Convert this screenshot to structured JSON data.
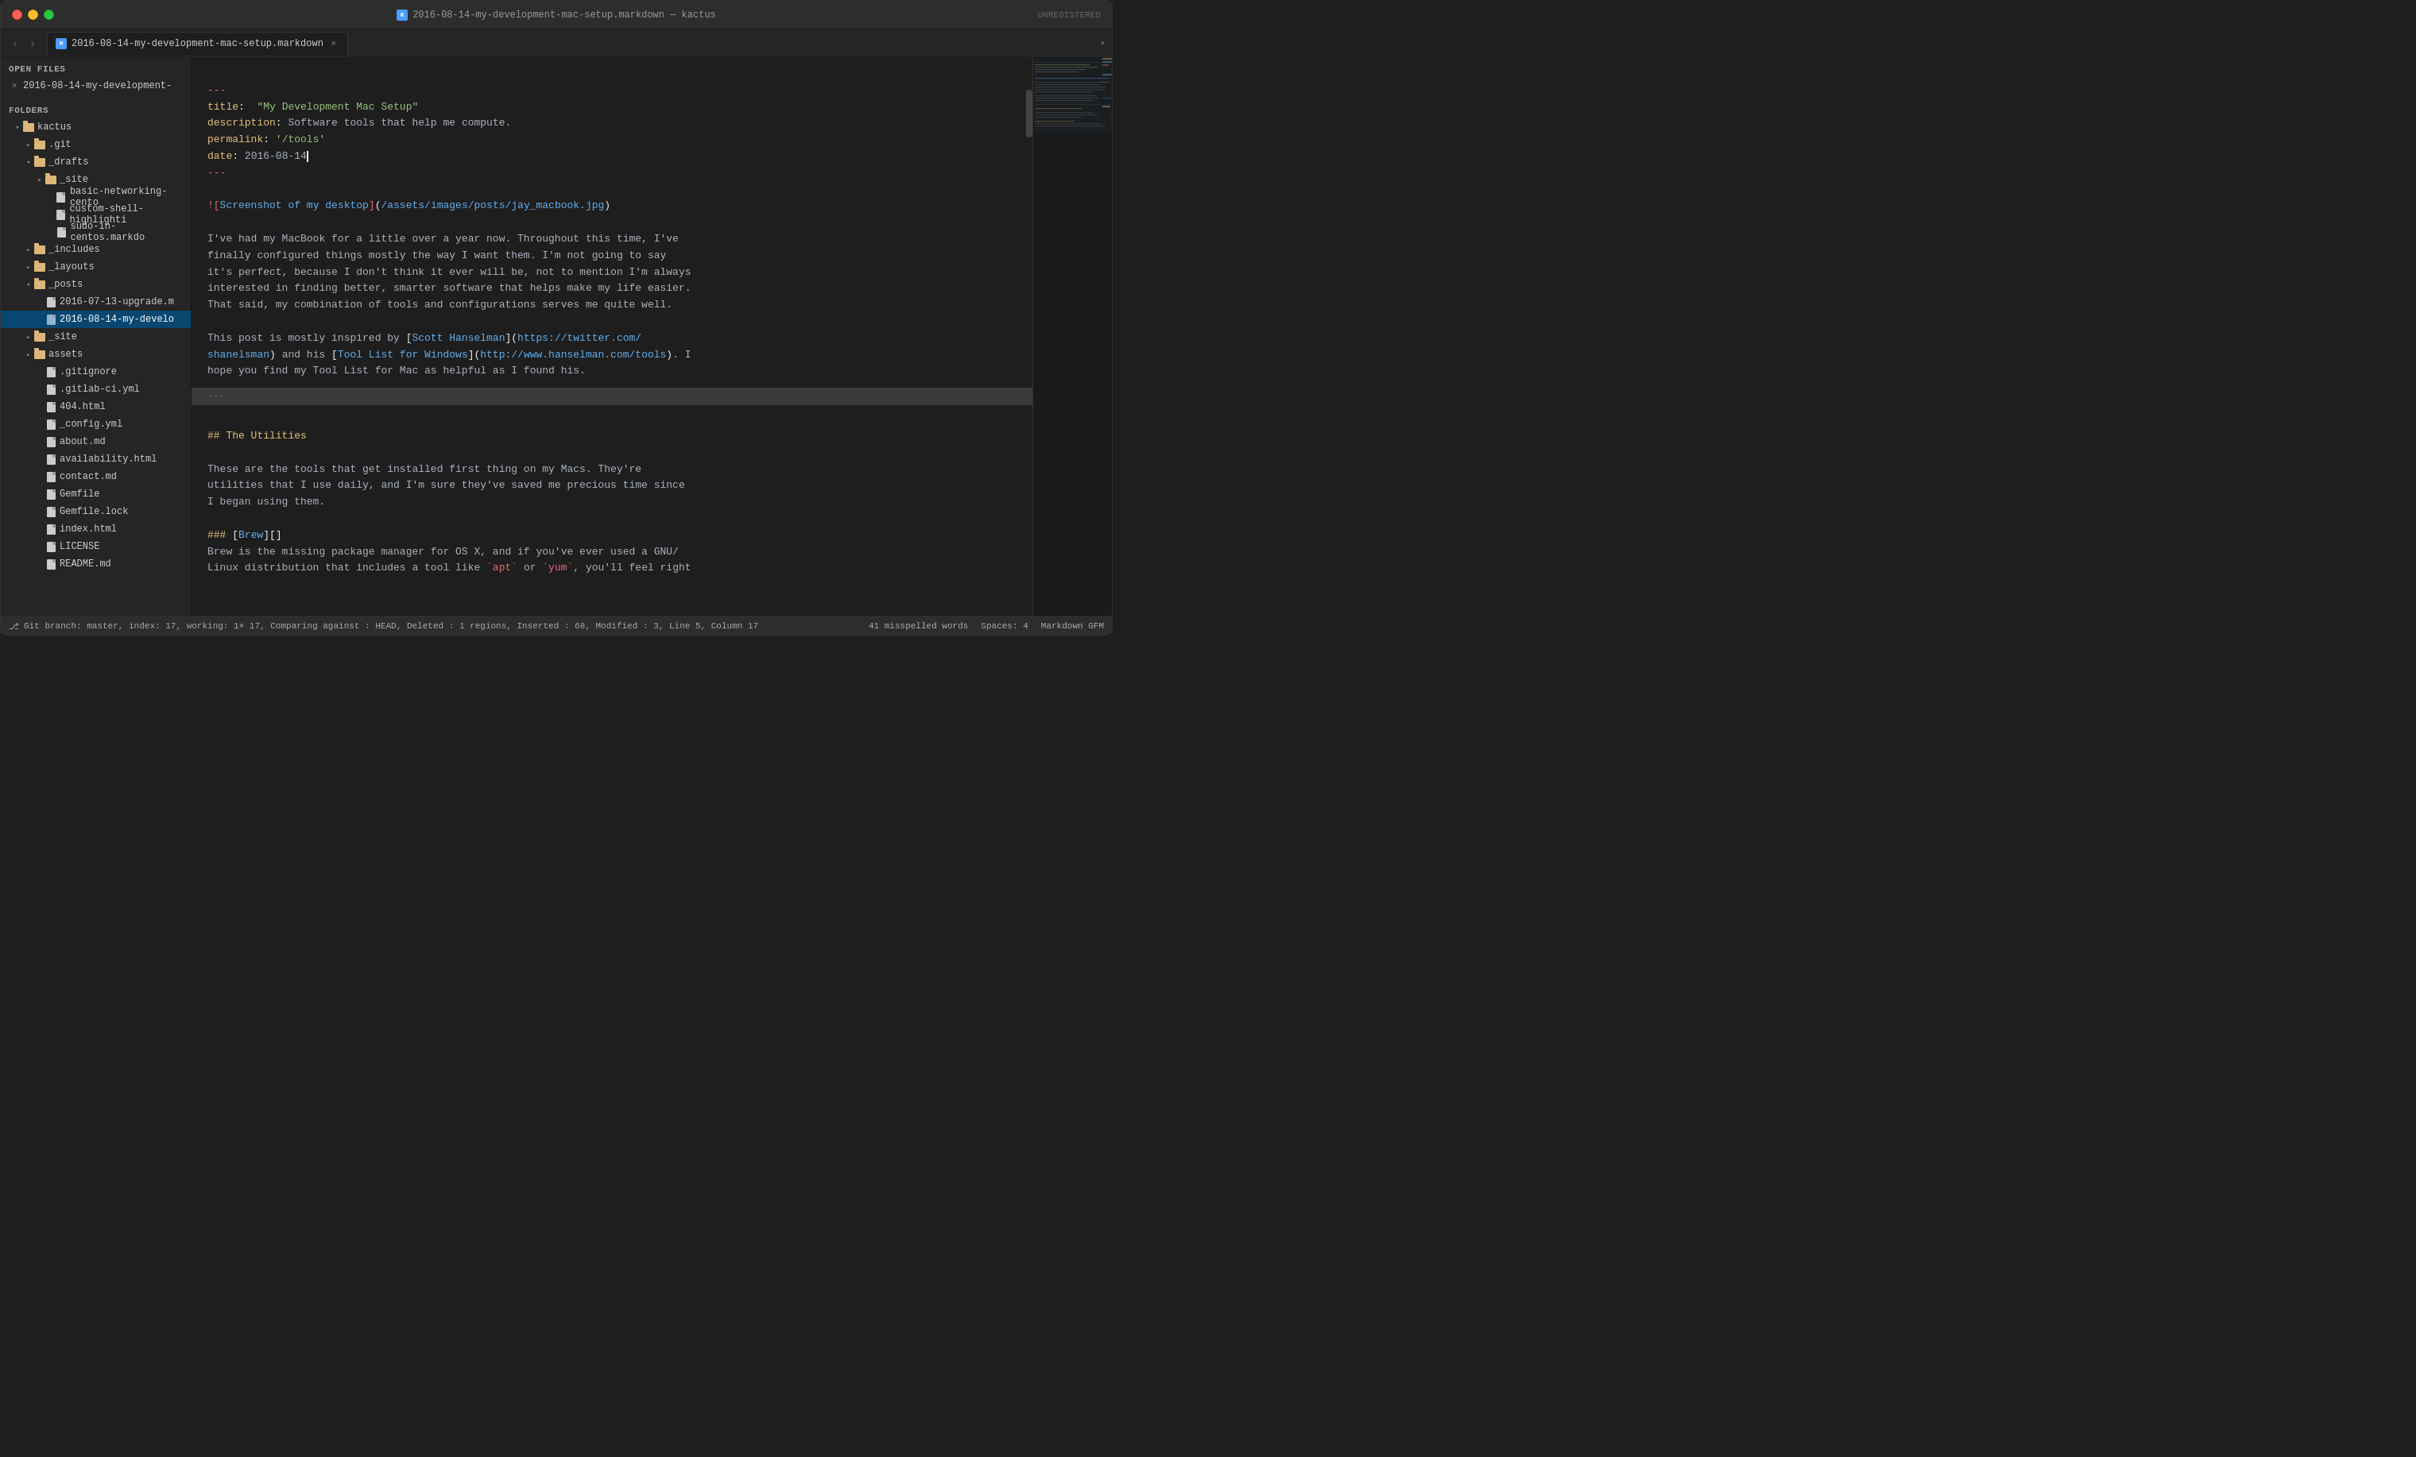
{
  "titlebar": {
    "filename": "2016-08-14-my-development-mac-setup.markdown",
    "app": "kactus",
    "full_title": "2016-08-14-my-development-mac-setup.markdown — kactus",
    "unregistered": "UNREGISTERED"
  },
  "tab": {
    "label": "2016-08-14-my-development-mac-setup.markdown",
    "close": "×"
  },
  "sidebar": {
    "open_files_header": "OPEN FILES",
    "folders_header": "FOLDERS",
    "open_file": "2016-08-14-my-development-",
    "root": "kactus",
    "items": [
      {
        "type": "folder",
        "label": ".git",
        "indent": 2,
        "expanded": false
      },
      {
        "type": "folder",
        "label": "_drafts",
        "indent": 2,
        "expanded": true
      },
      {
        "type": "folder",
        "label": "_site",
        "indent": 3,
        "expanded": false
      },
      {
        "type": "file",
        "label": "basic-networking-cento",
        "indent": 4
      },
      {
        "type": "file",
        "label": "custom-shell-highlighti",
        "indent": 4
      },
      {
        "type": "file",
        "label": "sudo-in-centos.markdo",
        "indent": 4
      },
      {
        "type": "folder",
        "label": "_includes",
        "indent": 2,
        "expanded": false
      },
      {
        "type": "folder",
        "label": "_layouts",
        "indent": 2,
        "expanded": false
      },
      {
        "type": "folder",
        "label": "_posts",
        "indent": 2,
        "expanded": true
      },
      {
        "type": "file",
        "label": "2016-07-13-upgrade.m",
        "indent": 3
      },
      {
        "type": "file",
        "label": "2016-08-14-my-develo",
        "indent": 3,
        "active": true
      },
      {
        "type": "folder",
        "label": "_site",
        "indent": 2,
        "expanded": false
      },
      {
        "type": "folder",
        "label": "assets",
        "indent": 2,
        "expanded": false
      },
      {
        "type": "file",
        "label": ".gitignore",
        "indent": 3
      },
      {
        "type": "file",
        "label": ".gitlab-ci.yml",
        "indent": 3
      },
      {
        "type": "file",
        "label": "404.html",
        "indent": 3
      },
      {
        "type": "file",
        "label": "_config.yml",
        "indent": 3
      },
      {
        "type": "file",
        "label": "about.md",
        "indent": 3
      },
      {
        "type": "file",
        "label": "availability.html",
        "indent": 3
      },
      {
        "type": "file",
        "label": "contact.md",
        "indent": 3
      },
      {
        "type": "file",
        "label": "Gemfile",
        "indent": 3
      },
      {
        "type": "file",
        "label": "Gemfile.lock",
        "indent": 3
      },
      {
        "type": "file",
        "label": "index.html",
        "indent": 3
      },
      {
        "type": "file",
        "label": "LICENSE",
        "indent": 3
      },
      {
        "type": "file",
        "label": "README.md",
        "indent": 3
      }
    ]
  },
  "editor": {
    "lines": [
      {
        "type": "separator",
        "text": "---"
      },
      {
        "type": "frontmatter_key",
        "key": "title:",
        "value": "  \"My Development Mac Setup\""
      },
      {
        "type": "frontmatter_key",
        "key": "description:",
        "value": " Software tools that help me compute."
      },
      {
        "type": "frontmatter_key",
        "key": "permalink:",
        "value": " '/tools'"
      },
      {
        "type": "frontmatter_key",
        "key": "date:",
        "value": " 2016-08-14"
      },
      {
        "type": "separator",
        "text": "---"
      },
      {
        "type": "blank"
      },
      {
        "type": "link_image",
        "text": "![Screenshot of my desktop](/assets/images/posts/jay_macbook.jpg)"
      },
      {
        "type": "blank"
      },
      {
        "type": "prose",
        "text": "I've had my MacBook for a little over a year now. Throughout this time, I've"
      },
      {
        "type": "prose",
        "text": "finally configured things mostly the way I want them. I'm not going to say"
      },
      {
        "type": "prose",
        "text": "it's perfect, because I don't think it ever will be, not to mention I'm always"
      },
      {
        "type": "prose",
        "text": "interested in finding better, smarter software that helps make my life easier."
      },
      {
        "type": "prose",
        "text": "That said, my combination of tools and configurations serves me quite well."
      },
      {
        "type": "blank"
      },
      {
        "type": "prose_link",
        "text": "This post is mostly inspired by [Scott Hanselman](https://twitter.com/"
      },
      {
        "type": "prose_link2",
        "text": "shanelsman) and his [Tool List for Windows](http://www.hanselman.com/tools). I"
      },
      {
        "type": "prose",
        "text": "hope you find my Tool List for Mac as helpful as I found his."
      },
      {
        "type": "blank"
      },
      {
        "type": "separator_line"
      },
      {
        "type": "blank"
      },
      {
        "type": "heading2",
        "text": "## The Utilities"
      },
      {
        "type": "blank"
      },
      {
        "type": "prose",
        "text": "These are the tools that get installed first thing on my Macs. They're"
      },
      {
        "type": "prose",
        "text": "utilities that I use daily, and I'm sure they've saved me precious time since"
      },
      {
        "type": "prose",
        "text": "I began using them."
      },
      {
        "type": "blank"
      },
      {
        "type": "heading3_link",
        "text": "### [Brew][]"
      },
      {
        "type": "prose",
        "text": "Brew is the missing package manager for OS X, and if you've ever used a GNU/"
      },
      {
        "type": "prose_cut",
        "text": "Linux distribution that includes a tool like `apt` or `yum`, you'll feel right"
      }
    ]
  },
  "statusbar": {
    "git_info": "Git branch: master, index: 17, working: 1× 17, Comparing against : HEAD, Deleted : 1 regions, Inserted : 68, Modified : 3, Line 5, Column 17",
    "misspelled": "41 misspelled words",
    "spaces": "Spaces: 4",
    "language": "Markdown GFM"
  }
}
